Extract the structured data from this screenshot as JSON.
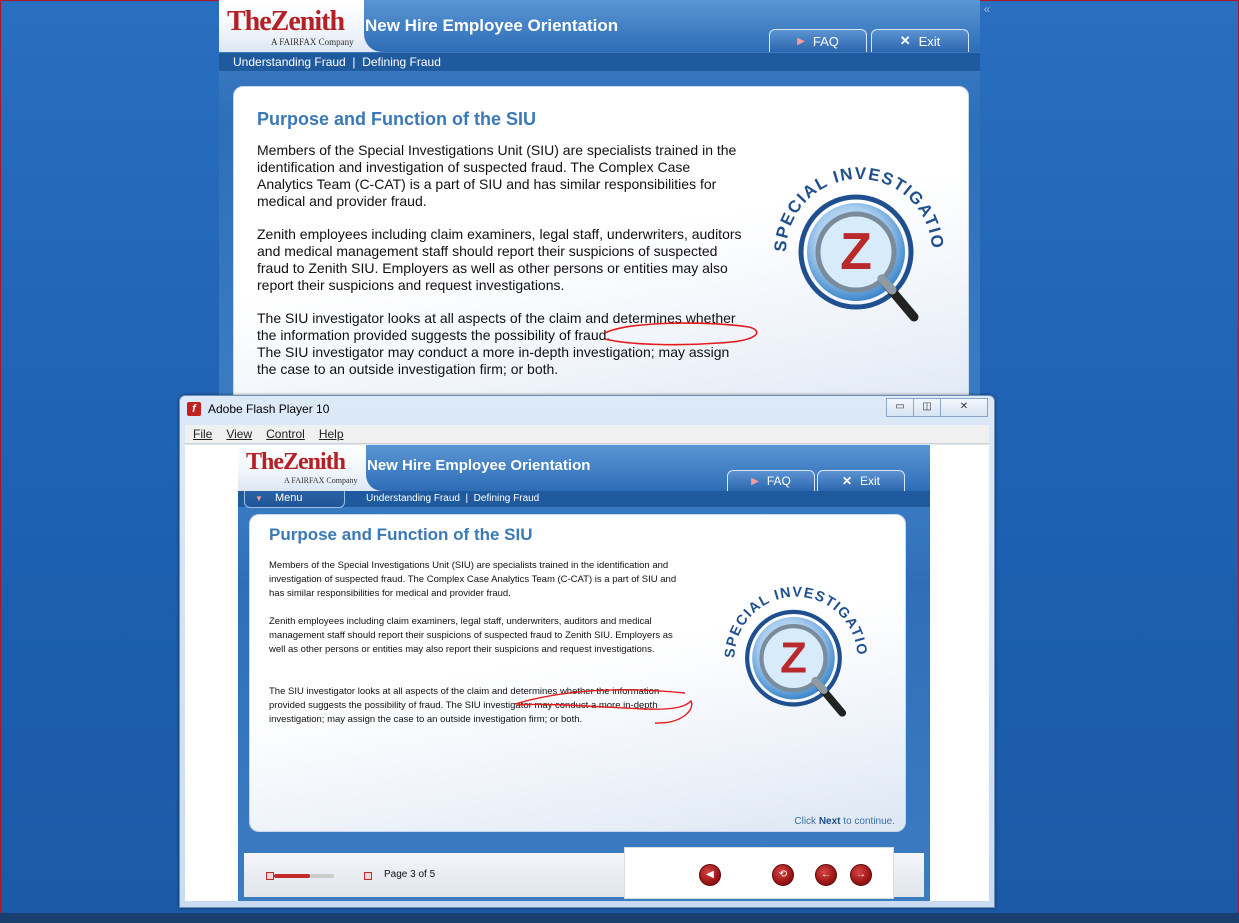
{
  "course": {
    "logo": "TheZenith",
    "logo_sub": "A FAIRFAX Company",
    "title": "New Hire Employee Orientation",
    "faq_label": "FAQ",
    "exit_label": "Exit",
    "breadcrumb": "Understanding Fraud  |  Defining Fraud",
    "menu_label": "Menu"
  },
  "slide": {
    "heading": "Purpose and Function of the SIU",
    "paragraphs": [
      "Members of the Special Investigations Unit (SIU) are specialists trained in the identification and investigation of suspected fraud. The Complex Case Analytics Team (C-CAT) is a part of SIU and has similar responsibilities for medical and provider fraud.",
      "Zenith employees including claim examiners, legal staff, underwriters, auditors and medical management staff should report their suspicions of suspected fraud to Zenith SIU. Employers as well as other persons or entities may also report their suspicions and request investigations.",
      "The SIU investigator looks at all aspects of the claim and determines whether the information provided suggests the possibility of fraud.",
      "The SIU investigator may conduct a more in-depth investigation; may assign the case to an outside investigation firm; or both."
    ],
    "badge_text": "SPECIAL INVESTIGATIONS UNIT",
    "badge_letter": "Z",
    "next_prefix": "Click ",
    "next_word": "Next",
    "next_suffix": " to continue."
  },
  "flash_window": {
    "title": "Adobe Flash Player 10",
    "menu": [
      "File",
      "View",
      "Control",
      "Help"
    ],
    "minimize": "▭",
    "restore": "◫",
    "close": "✕"
  },
  "player": {
    "page_text": "Page 3 of 5",
    "progress": 0.6,
    "controls": [
      "audio-button",
      "replay-button",
      "back-button",
      "next-button"
    ]
  },
  "colors": {
    "desktop": "#1f64b7",
    "accent": "#3b78b6",
    "brand_red": "#b52025",
    "annotation": "#e21b1b"
  }
}
